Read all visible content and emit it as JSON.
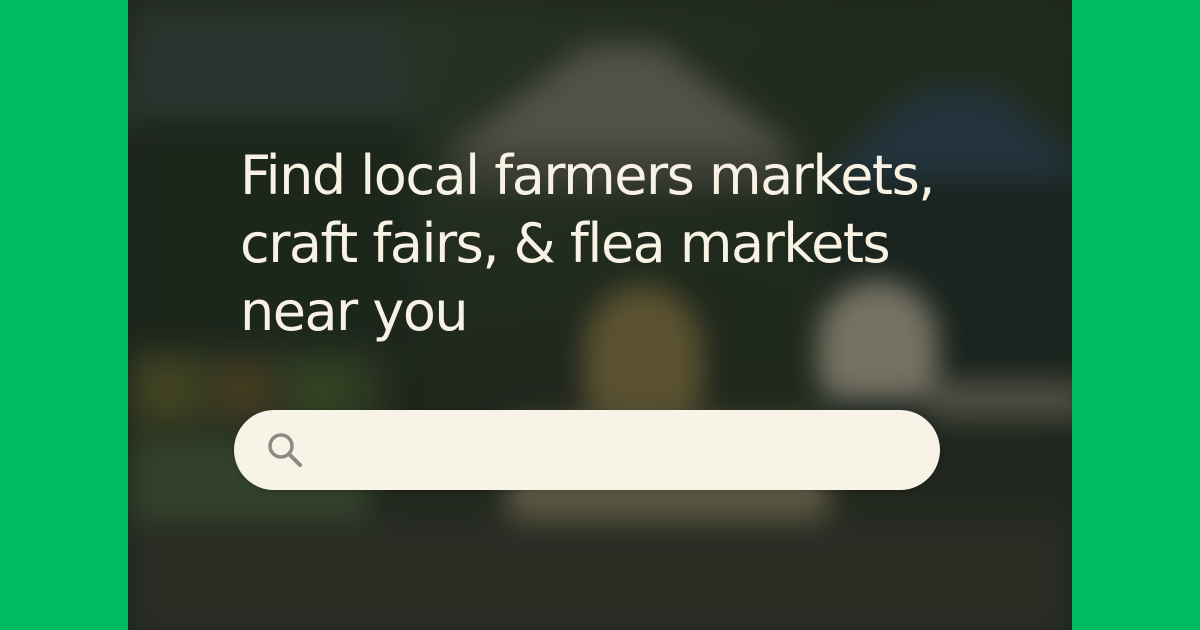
{
  "brand": {
    "accent_color": "#00bb5f",
    "search_bg_color": "#f7f3e7",
    "headline_color": "#f7f2e3"
  },
  "hero": {
    "headline_lines": [
      "Find local farmers markets,",
      "craft fairs, & flea markets",
      "near you"
    ],
    "background_image": "blurred outdoor market with tents"
  },
  "search": {
    "icon": "search-icon",
    "value": "",
    "placeholder": ""
  }
}
